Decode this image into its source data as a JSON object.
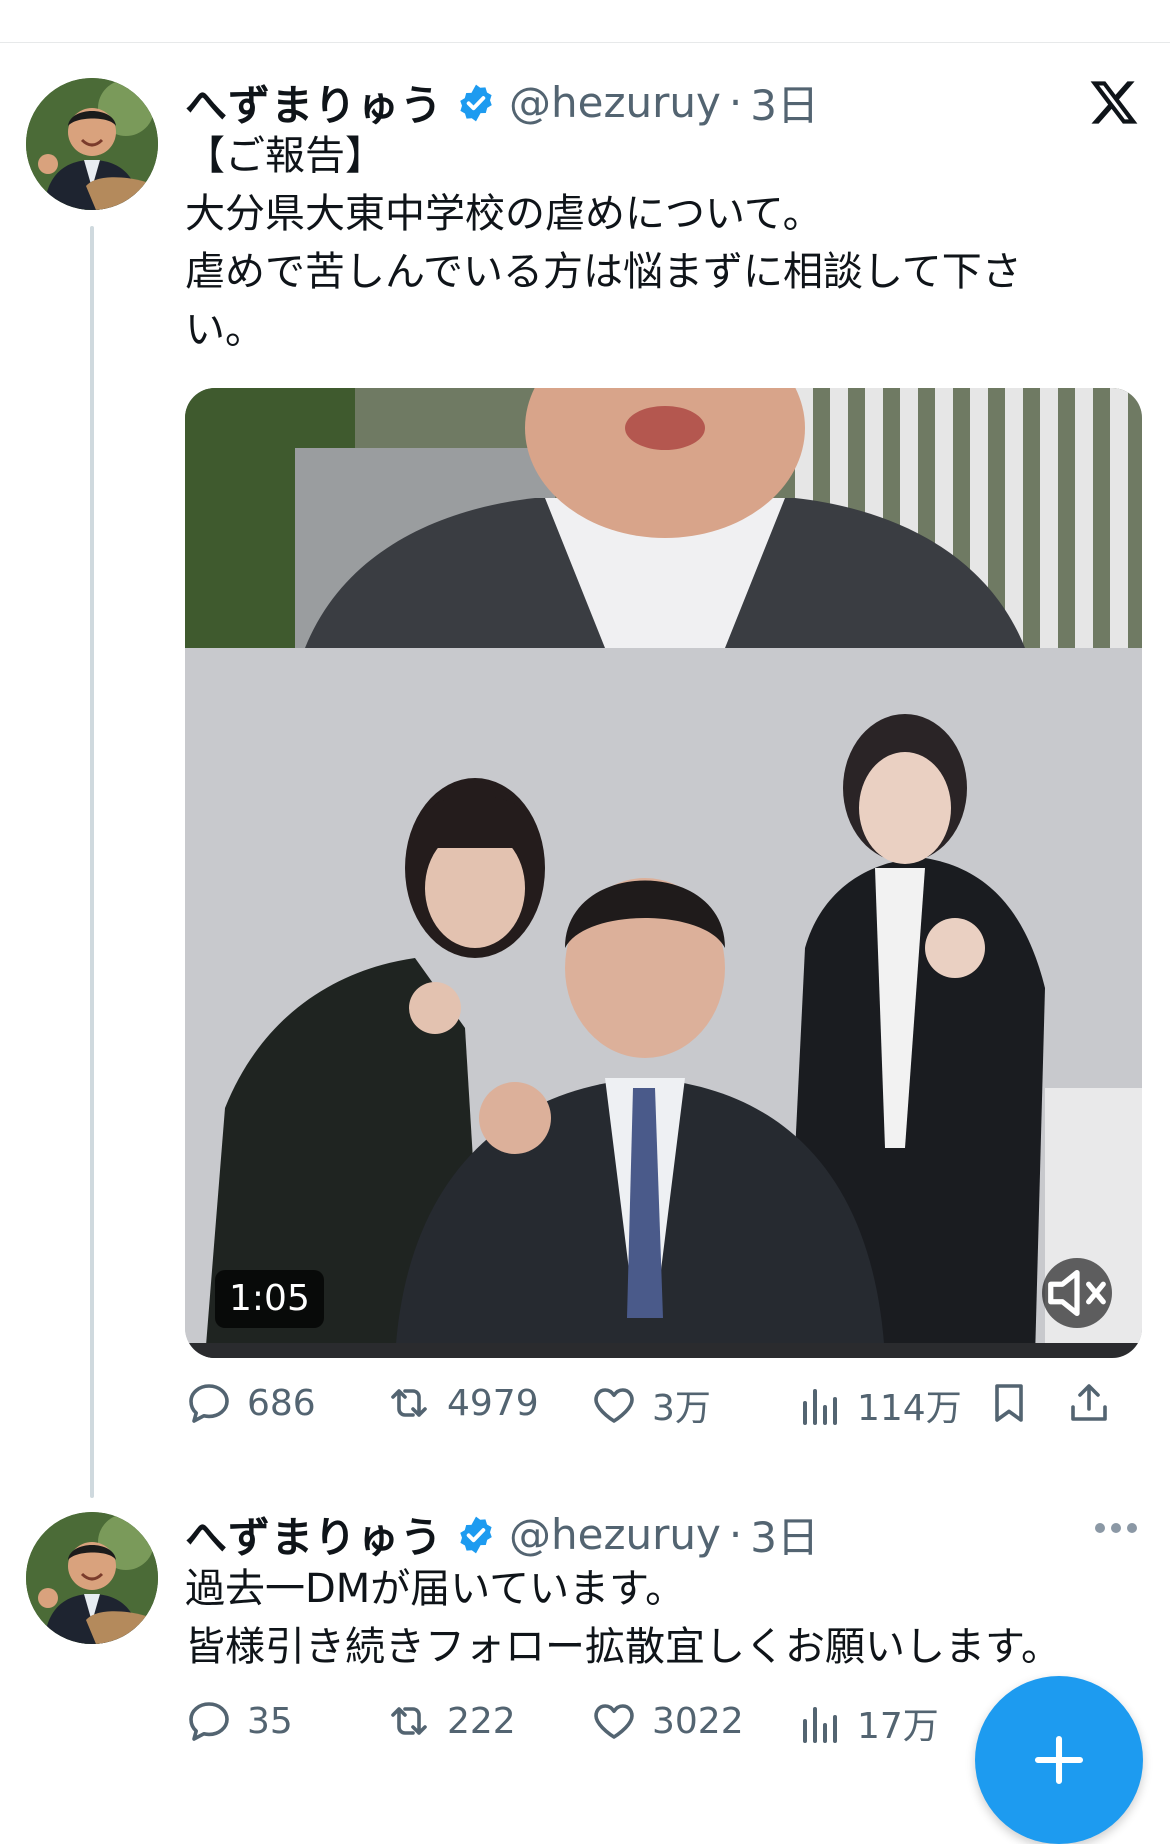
{
  "colors": {
    "accent": "#1d9bf0",
    "secondary_text": "#536471",
    "thread_line": "#cfd9de"
  },
  "tweets": [
    {
      "name": "へずまりゅう",
      "verified": true,
      "handle": "@hezuruy",
      "separator": "·",
      "time": "3日",
      "lines": [
        "【ご報告】",
        "大分県大東中学校の虐めについて。",
        "虐めで苦しんでいる方は悩まずに相談して下さ",
        "い。"
      ],
      "media": {
        "type": "video",
        "duration": "1:05",
        "muted": true
      },
      "stats": {
        "replies": "686",
        "retweets": "4979",
        "likes": "3万",
        "views": "114万"
      }
    },
    {
      "name": "へずまりゅう",
      "verified": true,
      "handle": "@hezuruy",
      "separator": "·",
      "time": "3日",
      "lines": [
        "過去一DMが届いています。",
        "皆様引き続きフォロー拡散宜しくお願いします。"
      ],
      "stats": {
        "replies": "35",
        "retweets": "222",
        "likes": "3022",
        "views": "17万"
      }
    }
  ],
  "icons": {
    "verified": "verified-badge-icon",
    "x_logo": "x-logo-icon",
    "reply": "reply-icon",
    "retweet": "retweet-icon",
    "like": "heart-icon",
    "views": "views-chart-icon",
    "bookmark": "bookmark-icon",
    "share": "share-icon",
    "more": "more-dots-icon",
    "mute": "mute-icon",
    "compose": "plus-icon"
  }
}
